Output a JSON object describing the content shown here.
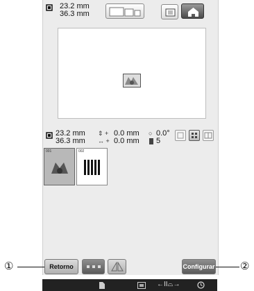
{
  "top_info": {
    "width": "23.2 mm",
    "height": "36.3 mm"
  },
  "bottom_info": {
    "width": "23.2 mm",
    "height": "36.3 mm",
    "offset_v": "0.0 mm",
    "offset_h": "0.0 mm",
    "angle": "0.0°",
    "colors": "5"
  },
  "thumbnails": [
    {
      "number": "001"
    },
    {
      "number": "002"
    }
  ],
  "buttons": {
    "retorno": "Retorno",
    "configurar": "Configurar"
  },
  "callouts": {
    "left": "①",
    "right": "②"
  },
  "status_bar": {
    "tension_symbol": "←II⌓→"
  }
}
